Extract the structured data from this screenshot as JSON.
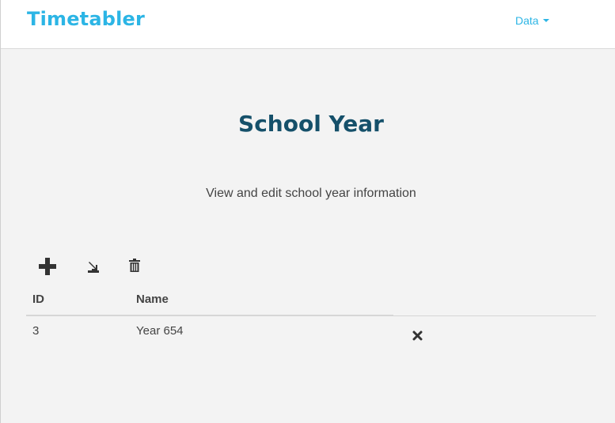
{
  "app": {
    "brand": "Timetabler",
    "nav": {
      "data_menu_label": "Data"
    }
  },
  "page": {
    "title": "School Year",
    "subtitle": "View and edit school year information"
  },
  "toolbar": {
    "icons": [
      "plus-icon",
      "export-icon",
      "trash-icon"
    ]
  },
  "table": {
    "columns": [
      "ID",
      "Name"
    ],
    "rows": [
      {
        "id": "3",
        "name": "Year 654"
      }
    ]
  },
  "colors": {
    "brand": "#2cb5e5",
    "title": "#15506a",
    "background": "#f3f3f3"
  }
}
